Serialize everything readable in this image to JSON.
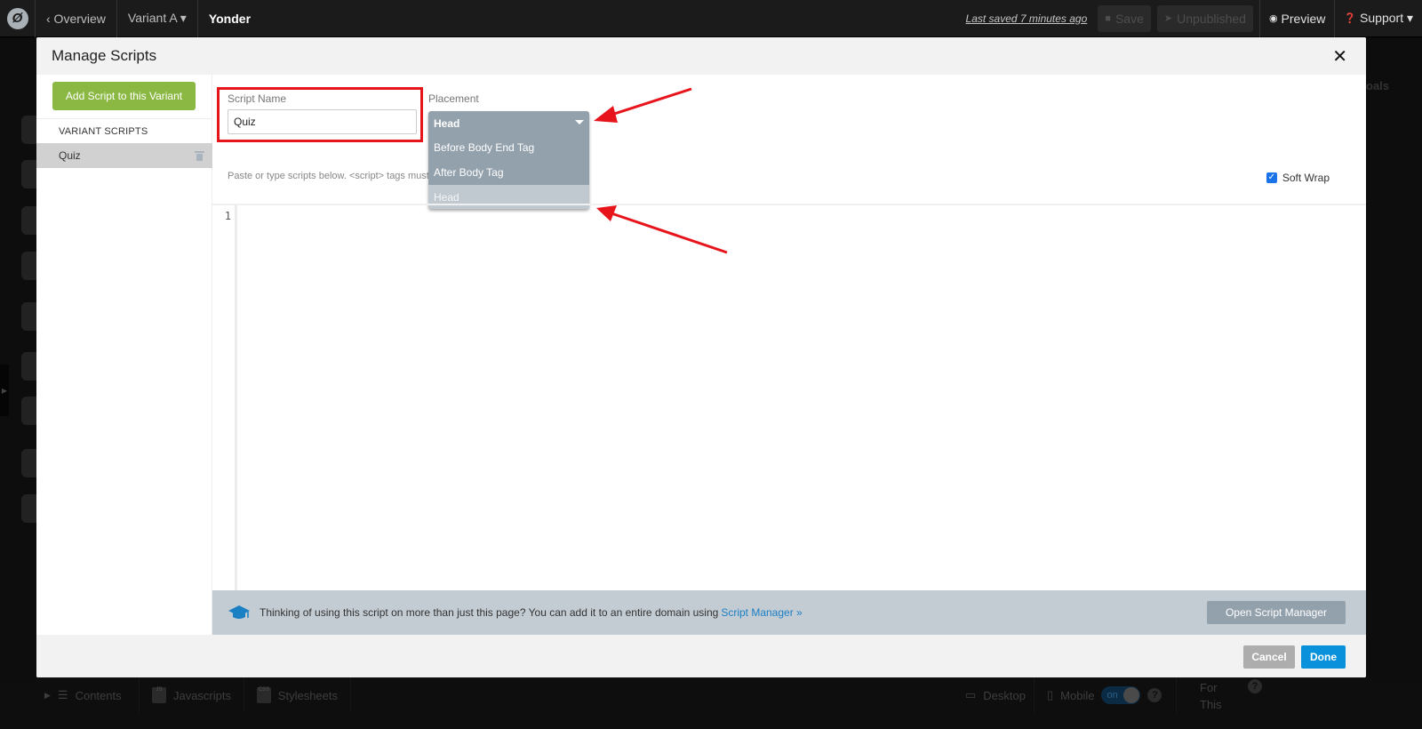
{
  "topbar": {
    "logo_glyph": "Ø",
    "back_label": "‹ Overview",
    "variant_label": "Variant A ▾",
    "page_title": "Yonder",
    "last_saved": "Last saved  7 minutes ago",
    "save_label": "Save",
    "unpublished_label": "Unpublished",
    "preview_label": "Preview",
    "support_label": "Support ▾"
  },
  "background": {
    "right_partial_label": "oals",
    "bottom_tabs": {
      "contents": "Contents",
      "javascripts": "Javascripts",
      "javascripts_icon_text": "JS",
      "stylesheets": "Stylesheets",
      "stylesheets_icon_text": "CSS",
      "desktop": "Desktop",
      "mobile": "Mobile",
      "mobile_toggle": "on",
      "for_this_line1": "For",
      "for_this_line2": "This"
    }
  },
  "modal": {
    "title": "Manage Scripts",
    "close_glyph": "✕",
    "sidebar": {
      "add_button_label": "Add Script to this Variant",
      "section_label": "VARIANT SCRIPTS",
      "scripts": [
        {
          "name": "Quiz"
        }
      ]
    },
    "form": {
      "script_name_label": "Script Name",
      "script_name_value": "Quiz",
      "placement_label": "Placement",
      "placement_selected": "Head",
      "placement_options": [
        {
          "label": "Before Body End Tag",
          "selected": false
        },
        {
          "label": "After Body Tag",
          "selected": false
        },
        {
          "label": "Head",
          "selected": true
        }
      ],
      "hint_text": "Paste or type scripts below. <script> tags must b",
      "soft_wrap_label": "Soft Wrap",
      "soft_wrap_checked": true
    },
    "editor": {
      "line_numbers": [
        "1"
      ],
      "content": ""
    },
    "info_bar": {
      "text": "Thinking of using this script on more than just this page? You can add it to an entire domain using",
      "link_label": "Script Manager »",
      "button_label": "Open Script Manager"
    },
    "footer": {
      "cancel_label": "Cancel",
      "done_label": "Done"
    }
  },
  "colors": {
    "accent_green": "#8ab843",
    "primary_blue": "#0a91dc",
    "link_blue": "#1b7fc4",
    "select_gray": "#93a1ad",
    "annotation_red": "#e8141c"
  }
}
